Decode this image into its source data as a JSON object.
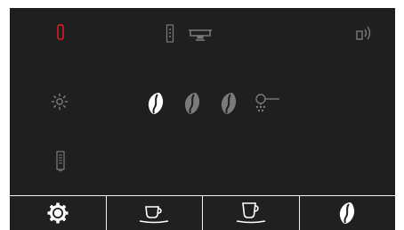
{
  "colors": {
    "screen_bg": "#1f1f1f",
    "alert_red": "#d11f24",
    "icon_gray": "#7a7a7a",
    "bean_white": "#ffffff",
    "bean_dim": "#7a7a7a"
  },
  "status_icons": [
    "water-tank-alert-icon",
    "grounds-container-icon",
    "drip-tray-icon",
    "remote-connection-icon",
    "brightness-icon",
    "grinder-setting-icon",
    "water-filter-icon"
  ],
  "strength": {
    "level": 1,
    "max": 3
  },
  "buttons": [
    {
      "id": "maintenance",
      "icon": "gear-icon"
    },
    {
      "id": "espresso",
      "icon": "espresso-cup-icon"
    },
    {
      "id": "coffee",
      "icon": "coffee-cup-icon"
    },
    {
      "id": "strength",
      "icon": "coffee-bean-icon"
    }
  ]
}
